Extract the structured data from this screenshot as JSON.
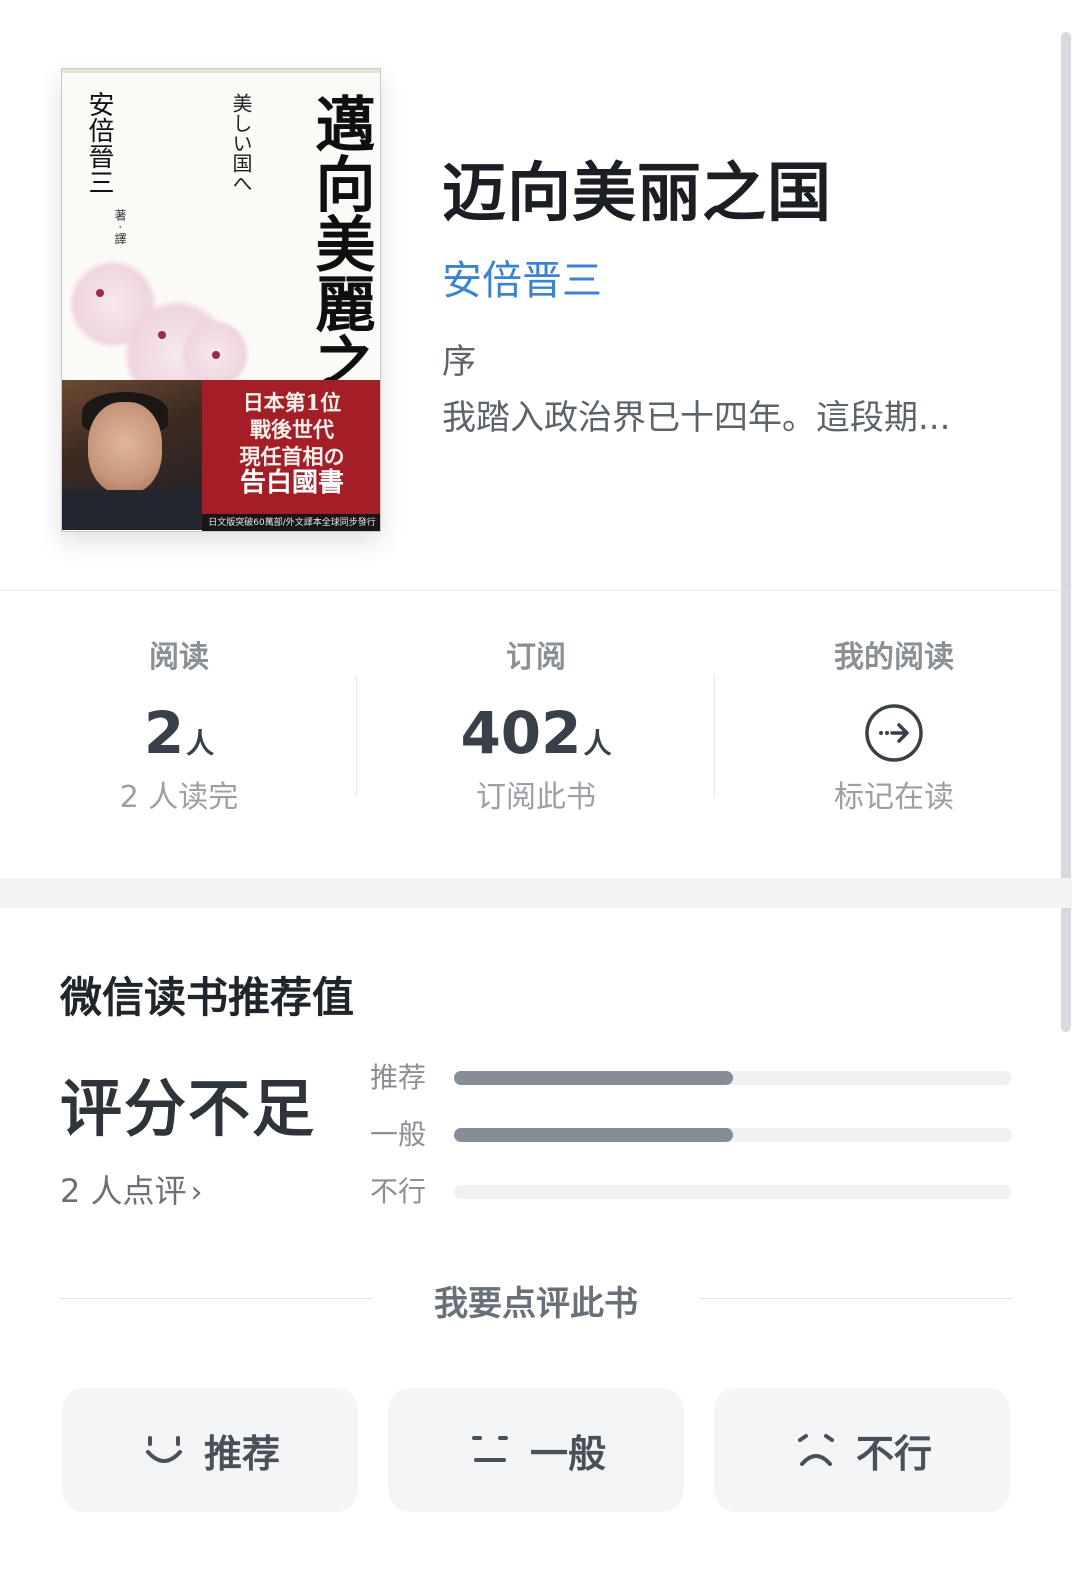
{
  "book": {
    "title": "迈向美丽之国",
    "author": "安倍晋三",
    "intro_heading": "序",
    "intro_excerpt": "我踏入政治界已十四年。這段期...",
    "cover": {
      "title": "邁向美麗之國",
      "subtitle": "美しい国へ",
      "author": "安倍晉三",
      "translator": "著 · 譯",
      "banner_lines": [
        "日本第1位",
        "戰後世代",
        "現任首相の"
      ],
      "banner_big": "告白國書",
      "bottom_text": "日文版突破60萬部/外文譯本全球同步發行"
    }
  },
  "stats": {
    "reading": {
      "label": "阅读",
      "value": "2",
      "unit": "人",
      "sub": "2 人读完"
    },
    "subscribe": {
      "label": "订阅",
      "value": "402",
      "unit": "人",
      "sub": "订阅此书"
    },
    "my_reading": {
      "label": "我的阅读",
      "icon": "arrow-circle-icon",
      "sub": "标记在读"
    }
  },
  "rating": {
    "title": "微信读书推荐值",
    "status": "评分不足",
    "reviewers": "2 人点评",
    "bars": [
      {
        "label": "推荐",
        "fraction": 0.5
      },
      {
        "label": "一般",
        "fraction": 0.5
      },
      {
        "label": "不行",
        "fraction": 0.0
      }
    ]
  },
  "review": {
    "prompt": "我要点评此书",
    "buttons": [
      {
        "label": "推荐",
        "icon": "smile-icon"
      },
      {
        "label": "一般",
        "icon": "neutral-face-icon"
      },
      {
        "label": "不行",
        "icon": "frown-icon"
      }
    ]
  },
  "colors": {
    "author_link": "#3b83d2",
    "bar_fill": "#878d96",
    "bar_track": "#f0f1f3",
    "cover_red": "#a41e28"
  }
}
